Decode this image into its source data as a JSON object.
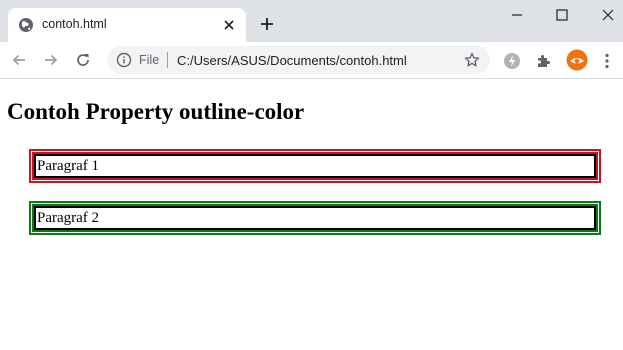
{
  "tab": {
    "title": "contoh.html"
  },
  "omnibox": {
    "scheme_label": "File",
    "url": "C:/Users/ASUS/Documents/contoh.html"
  },
  "page": {
    "heading": "Contoh Property outline-color",
    "paragraphs": [
      {
        "text": "Paragraf 1",
        "outline_color": "#c8141e"
      },
      {
        "text": "Paragraf 2",
        "outline_color": "#0a7a14"
      }
    ]
  },
  "colors": {
    "tabstrip": "#dee1e6",
    "omnibox": "#f1f3f4",
    "avatar": "#f0730f"
  },
  "icons": {
    "favicon": "globe-icon",
    "info": "info-icon",
    "bookmark": "star-icon",
    "extensions": [
      "speed-extension-icon",
      "puzzle-icon"
    ],
    "profile": "avatar",
    "menu": "kebab-menu-icon"
  }
}
